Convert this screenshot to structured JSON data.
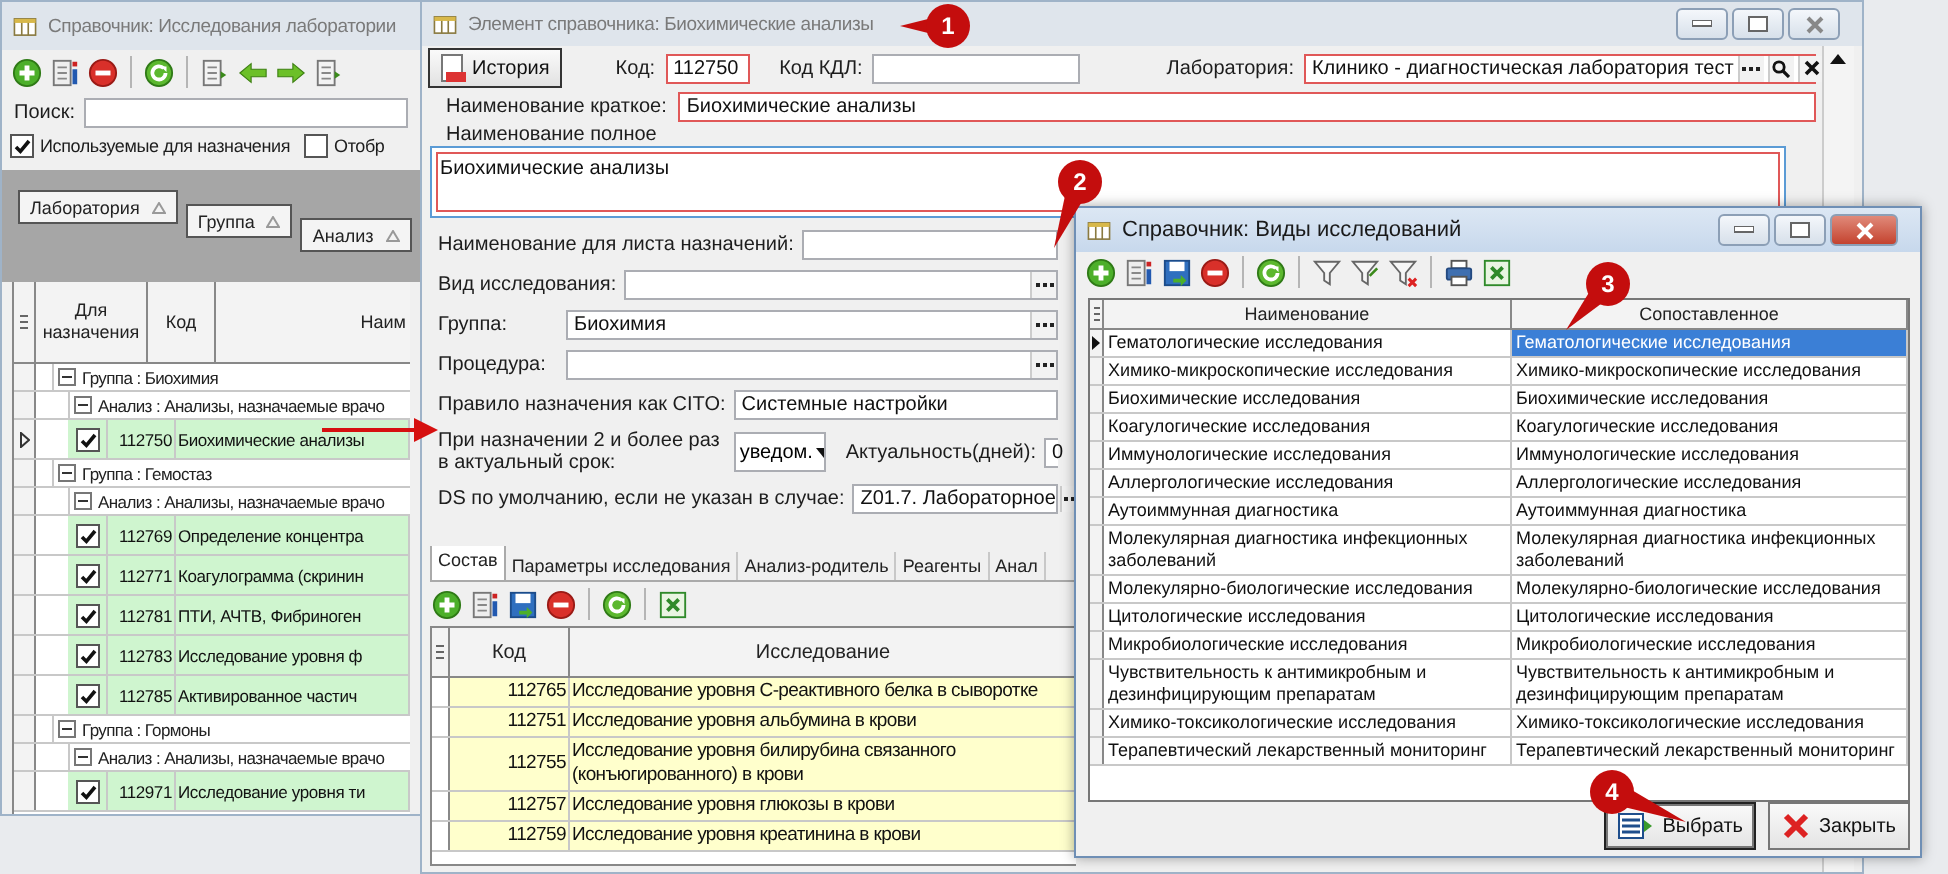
{
  "main_window": {
    "title": "Справочник: Исследования лаборатории",
    "search": {
      "label": "Поиск:"
    },
    "filters": [
      {
        "label": "Используемые для назначения",
        "checked": true
      },
      {
        "label": "Отобр",
        "checked": false
      }
    ],
    "group_by": [
      "Лаборатория",
      "Группа",
      "Анализ"
    ],
    "columns": [
      "Для назначения",
      "Код",
      "Наим"
    ],
    "tree": [
      {
        "label": "Группа : Биохимия",
        "expanded": true,
        "children": [
          {
            "label": "Анализ : Анализы, назначаемые врачо",
            "expanded": true,
            "children": [
              {
                "checked": true,
                "code": "112750",
                "name": "Биохимические анализы",
                "current": true
              }
            ]
          }
        ]
      },
      {
        "label": "Группа : Гемостаз",
        "expanded": true,
        "children": [
          {
            "label": "Анализ : Анализы, назначаемые врачо",
            "expanded": true,
            "children": [
              {
                "checked": true,
                "code": "112769",
                "name": "Определение концентра",
                "current": false
              },
              {
                "checked": true,
                "code": "112771",
                "name": "Коагулограмма (скринин",
                "current": false
              },
              {
                "checked": true,
                "code": "112781",
                "name": "ПТИ, АЧТВ, Фибриноген",
                "current": false
              },
              {
                "checked": true,
                "code": "112783",
                "name": "Исследование уровня ф",
                "current": false
              },
              {
                "checked": true,
                "code": "112785",
                "name": "Активированное частич",
                "current": false
              }
            ]
          }
        ]
      },
      {
        "label": "Группа : Гормоны",
        "expanded": true,
        "children": [
          {
            "label": "Анализ : Анализы, назначаемые врачо",
            "expanded": true,
            "children": [
              {
                "checked": true,
                "code": "112971",
                "name": "Исследование уровня ти",
                "current": false
              }
            ]
          }
        ]
      }
    ]
  },
  "element_window": {
    "title": "Элемент справочника: Биохимические анализы",
    "history_button": "История",
    "code": {
      "label": "Код:",
      "value": "112750",
      "required": true
    },
    "kdl": {
      "label": "Код КДЛ:",
      "required": false
    },
    "laboratory": {
      "label": "Лаборатория:",
      "value": "Клинико - диагностическая лаборатория тест",
      "required": true
    },
    "short_name": {
      "label": "Наименование краткое:",
      "value": "Биохимические анализы",
      "required": true
    },
    "full_name": {
      "label": "Наименование полное",
      "value": "Биохимические анализы",
      "required": true
    },
    "fields": [
      {
        "kind": "text",
        "label": "Наименование для листа назначений:"
      },
      {
        "kind": "lookup",
        "label": "Вид исследования:"
      },
      {
        "kind": "lookup",
        "label": "Группа:",
        "value": "Биохимия"
      },
      {
        "kind": "lookup",
        "label": "Процедура:"
      },
      {
        "kind": "text",
        "label": "Правило назначения как CITO:",
        "value": "Системные настройки"
      },
      {
        "kind": "select",
        "label": "При назначении 2 и более раз в актуальный срок:",
        "value": "уведом.",
        "extra_label": "Актуальность(дней):",
        "extra_value": "0"
      },
      {
        "kind": "lookup",
        "label": "DS по умолчанию, если не указан в случае:",
        "value": "Z01.7. Лабораторное"
      }
    ],
    "tabs": [
      {
        "label": "Состав",
        "selected": true
      },
      {
        "label": "Параметры исследования",
        "selected": false
      },
      {
        "label": "Анализ-родитель",
        "selected": false
      },
      {
        "label": "Реагенты",
        "selected": false
      },
      {
        "label": "Анал",
        "selected": false
      }
    ],
    "table": {
      "columns": [
        "Код",
        "Исследование"
      ],
      "rows": [
        {
          "code": "112765",
          "name": "Исследование уровня С-реактивного белка в сыворотке"
        },
        {
          "code": "112751",
          "name": "Исследование уровня альбумина в крови"
        },
        {
          "code": "112755",
          "name": "Исследование уровня билирубина связанного (конъюгированного) в крови"
        },
        {
          "code": "112757",
          "name": "Исследование уровня глюкозы в крови"
        },
        {
          "code": "112759",
          "name": "Исследование уровня креатинина в крови"
        }
      ]
    }
  },
  "types_dialog": {
    "title": "Справочник: Виды исследований",
    "columns": [
      "Наименование",
      "Сопоставленное"
    ],
    "rows": [
      {
        "name": "Гематологические исследования",
        "mapped": "Гематологические исследования",
        "selected": true
      },
      {
        "name": "Химико-микроскопические исследования",
        "mapped": "Химико-микроскопические исследования",
        "selected": false
      },
      {
        "name": "Биохимические исследования",
        "mapped": "Биохимические исследования",
        "selected": false
      },
      {
        "name": "Коагулогические исследования",
        "mapped": "Коагулогические исследования",
        "selected": false
      },
      {
        "name": "Иммунологические исследования",
        "mapped": "Иммунологические исследования",
        "selected": false
      },
      {
        "name": "Аллергологические исследования",
        "mapped": "Аллергологические исследования",
        "selected": false
      },
      {
        "name": "Аутоиммунная диагностика",
        "mapped": "Аутоиммунная диагностика",
        "selected": false
      },
      {
        "name": "Молекулярная диагностика инфекционных заболеваний",
        "mapped": "Молекулярная диагностика инфекционных заболеваний",
        "selected": false
      },
      {
        "name": "Молекулярно-биологические исследования",
        "mapped": "Молекулярно-биологические исследования",
        "selected": false
      },
      {
        "name": "Цитологические исследования",
        "mapped": "Цитологические исследования",
        "selected": false
      },
      {
        "name": "Микробиологические исследования",
        "mapped": "Микробиологические исследования",
        "selected": false
      },
      {
        "name": "Чувствительность к антимикробным и дезинфицирующим препаратам",
        "mapped": "Чувствительность к антимикробным и дезинфицирующим препаратам",
        "selected": false
      },
      {
        "name": "Химико-токсикологические исследования",
        "mapped": "Химико-токсикологические исследования",
        "selected": false
      },
      {
        "name": "Терапевтический лекарственный мониторинг",
        "mapped": "Терапевтический лекарственный мониторинг",
        "selected": false
      }
    ],
    "buttons": [
      {
        "kind": "select",
        "label": "Выбрать"
      },
      {
        "kind": "close",
        "label": "Закрыть"
      }
    ]
  },
  "callouts": [
    "1",
    "2",
    "3",
    "4"
  ]
}
